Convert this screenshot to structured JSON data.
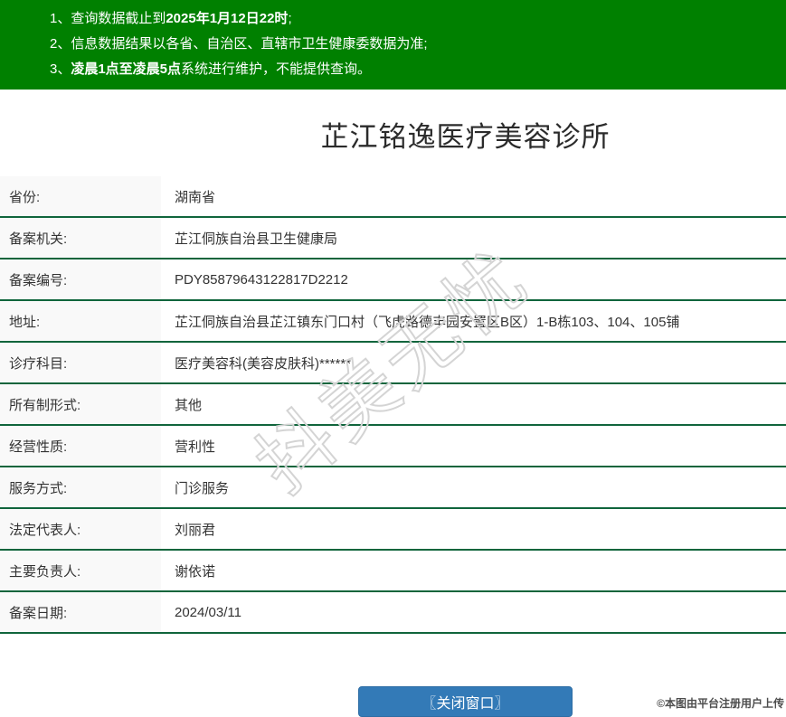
{
  "notice_banner": {
    "items": [
      {
        "prefix": "1、查询数据截止到",
        "bold": "2025年1月12日22时",
        "suffix": ";"
      },
      {
        "prefix": "2、信息数据结果以各省、自治区、直辖市卫生健康委数据为准;",
        "bold": "",
        "suffix": ""
      },
      {
        "prefix": "3、",
        "bold": "凌晨1点至凌晨5点",
        "suffix": "系统进行维护，不能提供查询。"
      }
    ]
  },
  "title": "芷江铭逸医疗美容诊所",
  "table": {
    "rows": [
      {
        "label": "省份:",
        "value": "湖南省"
      },
      {
        "label": "备案机关:",
        "value": "芷江侗族自治县卫生健康局"
      },
      {
        "label": "备案编号:",
        "value": "PDY85879643122817D2212"
      },
      {
        "label": "地址:",
        "value": "芷江侗族自治县芷江镇东门口村（飞虎路德丰园安置区B区）1-B栋103、104、105铺"
      },
      {
        "label": "诊疗科目:",
        "value": "医疗美容科(美容皮肤科)******"
      },
      {
        "label": "所有制形式:",
        "value": "其他"
      },
      {
        "label": "经营性质:",
        "value": "营利性"
      },
      {
        "label": "服务方式:",
        "value": "门诊服务"
      },
      {
        "label": "法定代表人:",
        "value": "刘丽君"
      },
      {
        "label": "主要负责人:",
        "value": "谢依诺"
      },
      {
        "label": "备案日期:",
        "value": "2024/03/11"
      }
    ]
  },
  "watermark": "抖美无忧",
  "footer": {
    "close_button": "〖关闭窗口〗",
    "copyright": "©本图由平台注册用户上传"
  },
  "colors": {
    "banner_green": "#008000",
    "row_border_green": "#10653c",
    "button_blue": "#337ab7",
    "label_cell_bg": "#f9f9f9",
    "watermark_gray": "#d4d4d4"
  }
}
